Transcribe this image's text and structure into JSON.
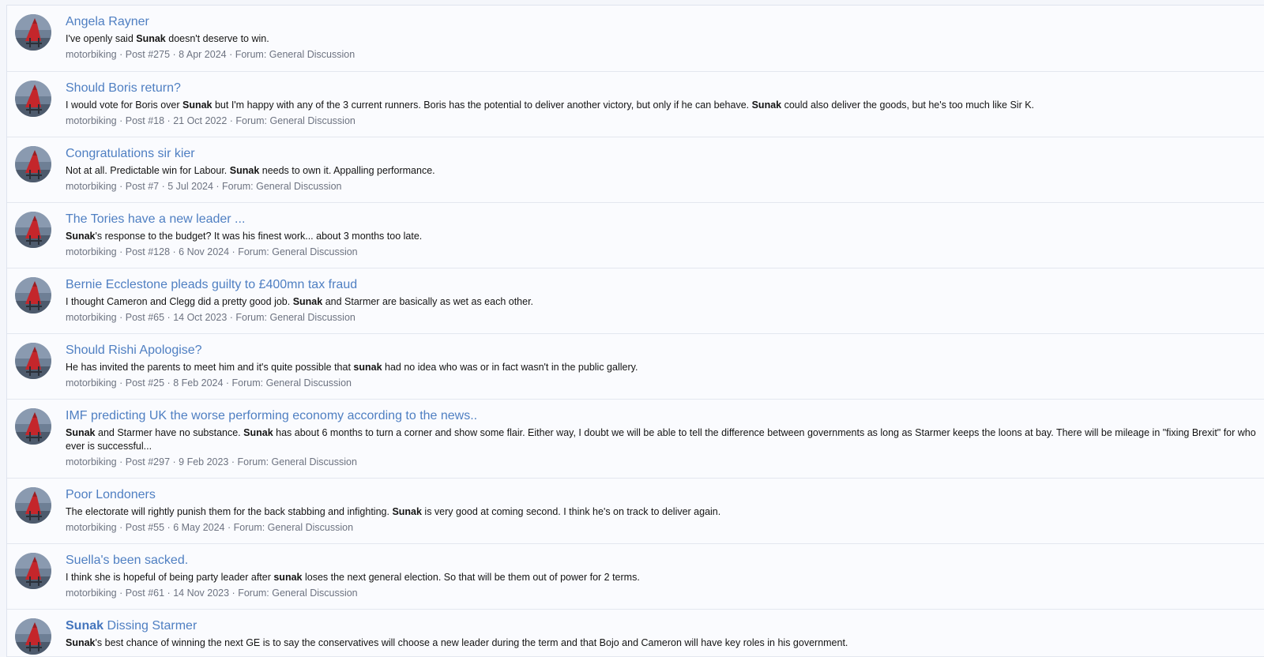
{
  "results": [
    {
      "title": [
        {
          "t": "Angela Rayner",
          "b": false
        }
      ],
      "snippet": [
        {
          "t": "I've openly said ",
          "b": false
        },
        {
          "t": "Sunak",
          "b": true
        },
        {
          "t": " doesn't deserve to win.",
          "b": false
        }
      ],
      "user": "motorbiking",
      "post": "Post #275",
      "date": "8 Apr 2024",
      "forum": "Forum: General Discussion"
    },
    {
      "title": [
        {
          "t": "Should Boris return?",
          "b": false
        }
      ],
      "snippet": [
        {
          "t": "I would vote for Boris over ",
          "b": false
        },
        {
          "t": "Sunak",
          "b": true
        },
        {
          "t": " but I'm happy with any of the 3 current runners. Boris has the potential to deliver another victory, but only if he can behave. ",
          "b": false
        },
        {
          "t": "Sunak",
          "b": true
        },
        {
          "t": " could also deliver the goods, but he's too much like Sir K.",
          "b": false
        }
      ],
      "user": "motorbiking",
      "post": "Post #18",
      "date": "21 Oct 2022",
      "forum": "Forum: General Discussion"
    },
    {
      "title": [
        {
          "t": "Congratulations sir kier",
          "b": false
        }
      ],
      "snippet": [
        {
          "t": "Not at all. Predictable win for Labour. ",
          "b": false
        },
        {
          "t": "Sunak",
          "b": true
        },
        {
          "t": " needs to own it. Appalling performance.",
          "b": false
        }
      ],
      "user": "motorbiking",
      "post": "Post #7",
      "date": "5 Jul 2024",
      "forum": "Forum: General Discussion"
    },
    {
      "title": [
        {
          "t": "The Tories have a new leader ...",
          "b": false
        }
      ],
      "snippet": [
        {
          "t": "Sunak",
          "b": true
        },
        {
          "t": "'s response to the budget? It was his finest work... about 3 months too late.",
          "b": false
        }
      ],
      "user": "motorbiking",
      "post": "Post #128",
      "date": "6 Nov 2024",
      "forum": "Forum: General Discussion"
    },
    {
      "title": [
        {
          "t": "Bernie Ecclestone pleads guilty to £400mn tax fraud",
          "b": false
        }
      ],
      "snippet": [
        {
          "t": "I thought Cameron and Clegg did a pretty good job. ",
          "b": false
        },
        {
          "t": "Sunak",
          "b": true
        },
        {
          "t": " and Starmer are basically as wet as each other.",
          "b": false
        }
      ],
      "user": "motorbiking",
      "post": "Post #65",
      "date": "14 Oct 2023",
      "forum": "Forum: General Discussion"
    },
    {
      "title": [
        {
          "t": "Should Rishi Apologise?",
          "b": false
        }
      ],
      "snippet": [
        {
          "t": "He has invited the parents to meet him and it's quite possible that ",
          "b": false
        },
        {
          "t": "sunak",
          "b": true
        },
        {
          "t": " had no idea who was or in fact wasn't in the public gallery.",
          "b": false
        }
      ],
      "user": "motorbiking",
      "post": "Post #25",
      "date": "8 Feb 2024",
      "forum": "Forum: General Discussion"
    },
    {
      "title": [
        {
          "t": "IMF predicting UK the worse performing economy according to the news..",
          "b": false
        }
      ],
      "snippet": [
        {
          "t": "Sunak",
          "b": true
        },
        {
          "t": " and Starmer have no substance. ",
          "b": false
        },
        {
          "t": "Sunak",
          "b": true
        },
        {
          "t": " has about 6 months to turn a corner and show some flair. Either way, I doubt we will be able to tell the difference between governments as long as Starmer keeps the loons at bay. There will be mileage in \"fixing Brexit\" for who ever is successful...",
          "b": false
        }
      ],
      "user": "motorbiking",
      "post": "Post #297",
      "date": "9 Feb 2023",
      "forum": "Forum: General Discussion"
    },
    {
      "title": [
        {
          "t": "Poor Londoners",
          "b": false
        }
      ],
      "snippet": [
        {
          "t": "The electorate will rightly punish them for the back stabbing and infighting. ",
          "b": false
        },
        {
          "t": "Sunak",
          "b": true
        },
        {
          "t": " is very good at coming second. I think he's on track to deliver again.",
          "b": false
        }
      ],
      "user": "motorbiking",
      "post": "Post #55",
      "date": "6 May 2024",
      "forum": "Forum: General Discussion"
    },
    {
      "title": [
        {
          "t": "Suella's been sacked.",
          "b": false
        }
      ],
      "snippet": [
        {
          "t": "I think she is hopeful of being party leader after ",
          "b": false
        },
        {
          "t": "sunak",
          "b": true
        },
        {
          "t": " loses the next general election. So that will be them out of power for 2 terms.",
          "b": false
        }
      ],
      "user": "motorbiking",
      "post": "Post #61",
      "date": "14 Nov 2023",
      "forum": "Forum: General Discussion"
    },
    {
      "title": [
        {
          "t": "Sunak",
          "b": true
        },
        {
          "t": " Dissing Starmer",
          "b": false
        }
      ],
      "snippet": [
        {
          "t": "Sunak",
          "b": true
        },
        {
          "t": "'s best chance of winning the next GE is to say the conservatives will choose a new leader during the term and that Bojo and Cameron will have key roles in his government.",
          "b": false
        }
      ],
      "user": "",
      "post": "",
      "date": "",
      "forum": ""
    }
  ],
  "meta_separator": " · ",
  "colors": {
    "link": "#4f7fc2",
    "text": "#141414",
    "meta": "#6d7381",
    "row_bg": "#fafbfe",
    "border": "#e3e7ef"
  },
  "icons": {
    "avatar": "avatar-icon"
  }
}
